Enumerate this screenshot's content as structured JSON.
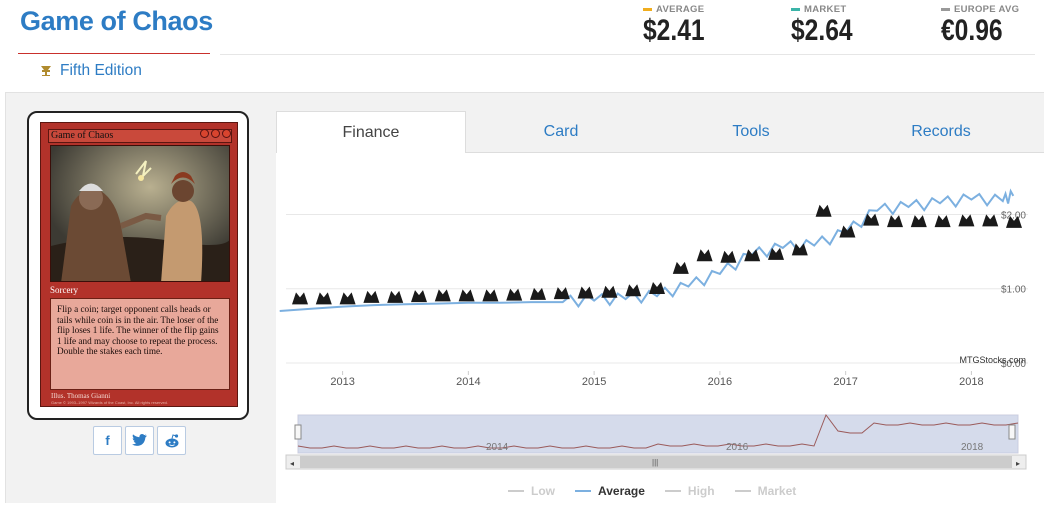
{
  "header": {
    "title": "Game of Chaos",
    "set_name": "Fifth Edition",
    "prices": [
      {
        "label": "AVERAGE",
        "value": "$2.41",
        "color": "#f0ad1e"
      },
      {
        "label": "MARKET",
        "value": "$2.64",
        "color": "#3bb4a8"
      },
      {
        "label": "EUROPE AVG",
        "value": "€0.96",
        "color": "#999999"
      }
    ]
  },
  "card": {
    "name": "Game of Chaos",
    "type_line": "Sorcery",
    "rules_text": "Flip a coin; target opponent calls heads or tails while coin is in the air. The loser of the flip loses 1 life. The winner of the flip gains 1 life and may choose to repeat the process. Double the stakes each time.",
    "illustrator": "Illus. Thomas Gianni",
    "copyright": "Game © 1993–1997 Wizards of the Coast, Inc. All rights reserved."
  },
  "share": {
    "facebook": "f",
    "twitter": "t",
    "reddit": "r"
  },
  "tabs": [
    "Finance",
    "Card",
    "Tools",
    "Records"
  ],
  "active_tab": "Finance",
  "chart": {
    "watermark": "MTGStocks.com",
    "y_labels": [
      "$2.00",
      "$1.00",
      "$0.00"
    ],
    "x_labels": [
      "2013",
      "2014",
      "2015",
      "2016",
      "2017",
      "2018"
    ],
    "nav_x_labels": [
      "2014",
      "2016",
      "2018"
    ],
    "legend": [
      "Low",
      "Average",
      "High",
      "Market"
    ],
    "active_legend": "Average"
  },
  "chart_data": {
    "type": "line",
    "title": "",
    "xlabel": "",
    "ylabel": "",
    "ylim": [
      0,
      2.5
    ],
    "x": [
      "2012-07",
      "2012-10",
      "2013-01",
      "2013-04",
      "2013-07",
      "2013-10",
      "2014-01",
      "2014-04",
      "2014-07",
      "2014-10",
      "2015-01",
      "2015-04",
      "2015-07",
      "2015-10",
      "2016-01",
      "2016-04",
      "2016-07",
      "2016-10",
      "2017-01",
      "2017-04",
      "2017-07",
      "2017-10",
      "2018-01",
      "2018-04",
      "2018-05"
    ],
    "series": [
      {
        "name": "Average",
        "color": "#7cb0e0",
        "values": [
          0.7,
          0.73,
          0.76,
          0.78,
          0.79,
          0.8,
          0.81,
          0.81,
          0.82,
          0.82,
          0.84,
          0.86,
          0.9,
          1.03,
          1.2,
          1.45,
          1.55,
          1.58,
          1.75,
          2.05,
          2.1,
          2.15,
          2.2,
          2.18,
          2.25
        ]
      }
    ]
  }
}
